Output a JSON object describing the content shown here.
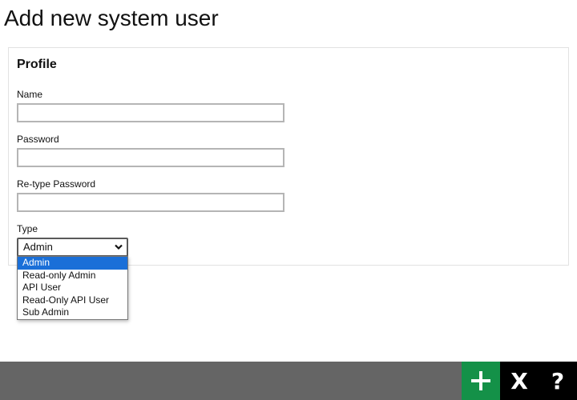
{
  "page": {
    "title": "Add new system user"
  },
  "profile": {
    "title": "Profile",
    "fields": {
      "name": {
        "label": "Name",
        "value": "",
        "placeholder": ""
      },
      "password": {
        "label": "Password",
        "value": "",
        "placeholder": ""
      },
      "retype_password": {
        "label": "Re-type Password",
        "value": "",
        "placeholder": ""
      },
      "type": {
        "label": "Type",
        "selected": "Admin",
        "options": [
          "Admin",
          "Read-only Admin",
          "API User",
          "Read-Only API User",
          "Sub Admin"
        ],
        "highlighted_index": 0,
        "expanded": true
      }
    }
  },
  "toolbar": {
    "add_icon": "plus-icon",
    "close_label": "X",
    "help_label": "?",
    "colors": {
      "bar": "#656565",
      "add": "#149148",
      "close": "#000000",
      "help": "#000000"
    }
  },
  "colors": {
    "selection": "#1a6fd8"
  }
}
